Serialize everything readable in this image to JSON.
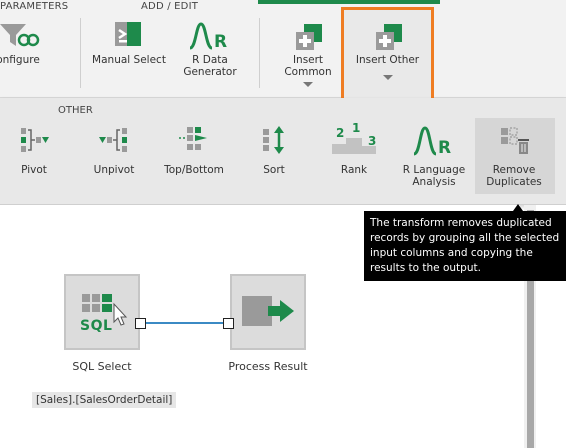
{
  "ribbon": {
    "groups": {
      "parameters": "PARAMETERS",
      "add_edit": "ADD / EDIT"
    },
    "buttons": {
      "configure": "onfigure",
      "manual_select": "Manual Select",
      "r_data_generator_line1": "R Data",
      "r_data_generator_line2": "Generator",
      "insert_common_line1": "Insert",
      "insert_common_line2": "Common",
      "insert_other": "Insert Other"
    }
  },
  "other_panel": {
    "label": "OTHER",
    "buttons": {
      "pivot": "Pivot",
      "unpivot": "Unpivot",
      "top_bottom": "Top/Bottom",
      "sort": "Sort",
      "rank": "Rank",
      "r_language_line1": "R Language",
      "r_language_line2": "Analysis",
      "remove_duplicates_line1": "Remove",
      "remove_duplicates_line2": "Duplicates"
    },
    "rank_digits": [
      "2",
      "1",
      "3"
    ]
  },
  "canvas": {
    "sql_select": {
      "icon_text": "SQL",
      "label": "SQL Select",
      "caption": "[Sales].[SalesOrderDetail]"
    },
    "process_result": {
      "label": "Process Result"
    }
  },
  "tooltip": {
    "text": "The transform removes duplicated records by grouping all the selected input columns and copying the results to the output."
  },
  "colors": {
    "accent_green": "#1e8a4b",
    "highlight_orange": "#ef7d23",
    "connector_blue": "#3b8ac4"
  }
}
